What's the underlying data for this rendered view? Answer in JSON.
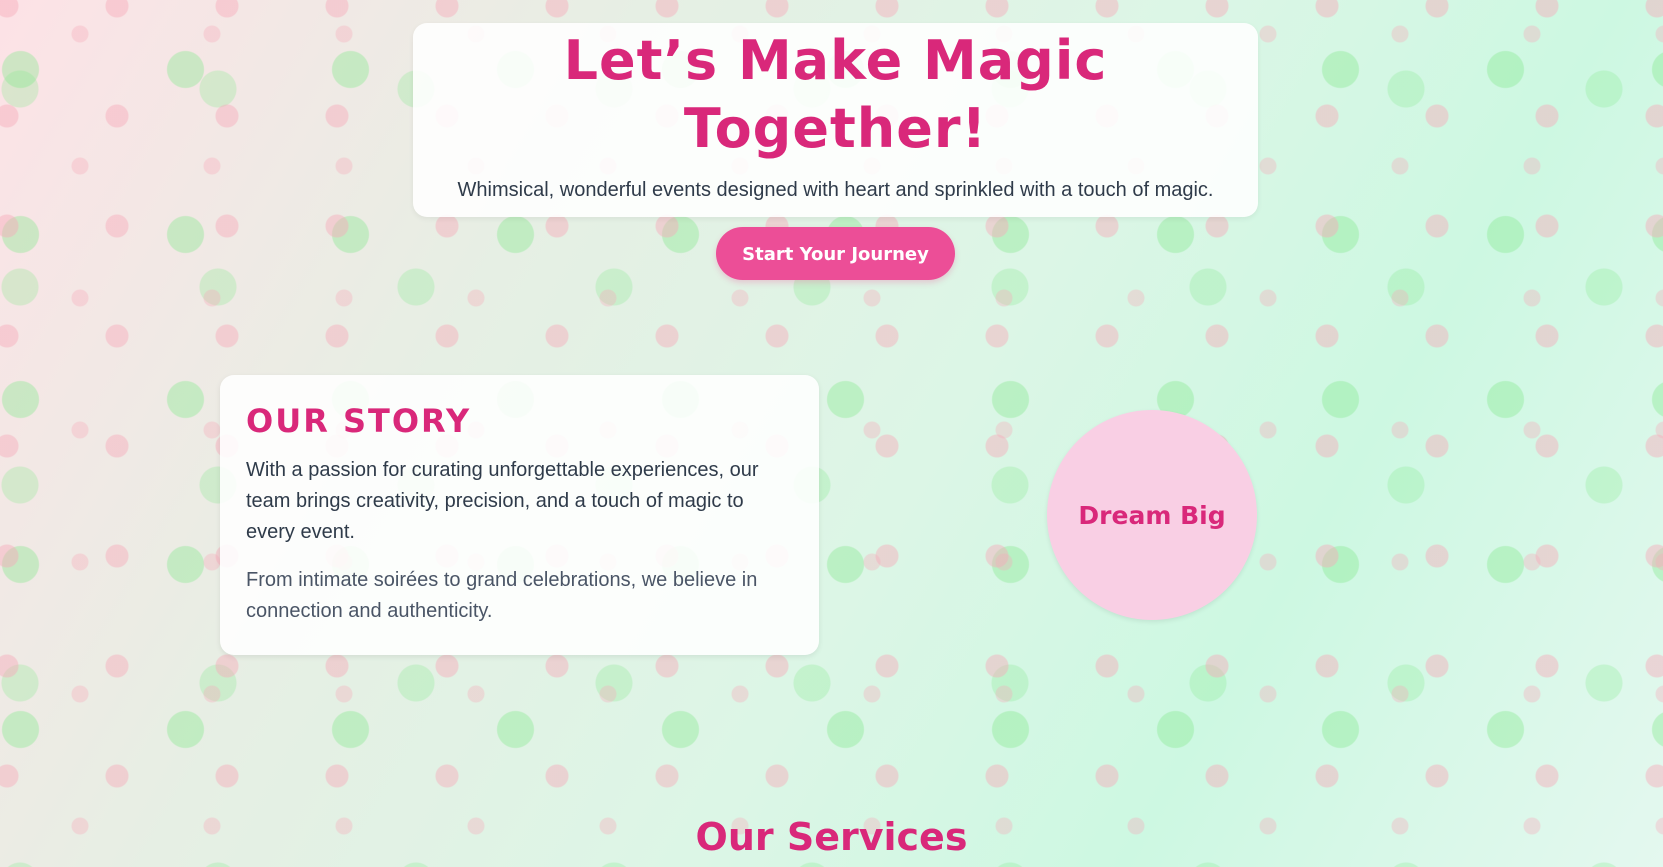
{
  "hero": {
    "title": "Let’s Make Magic Together!",
    "subtitle": "Whimsical, wonderful events designed with heart and sprinkled with a touch of magic.",
    "cta_label": "Start Your Journey"
  },
  "story": {
    "heading": "OUR STORY",
    "paragraph_1": "With a passion for curating unforgettable experiences, our team brings creativity, precision, and a touch of magic to every event.",
    "paragraph_2": "From intimate soirées to grand celebrations, we believe in connection and authenticity."
  },
  "badge": {
    "label": "Dream Big"
  },
  "services": {
    "heading": "Our Services"
  },
  "colors": {
    "accent": "#d9287a",
    "button": "#ec4e97",
    "badge_bg": "#f9cfe4",
    "text": "#2f3b4a"
  }
}
